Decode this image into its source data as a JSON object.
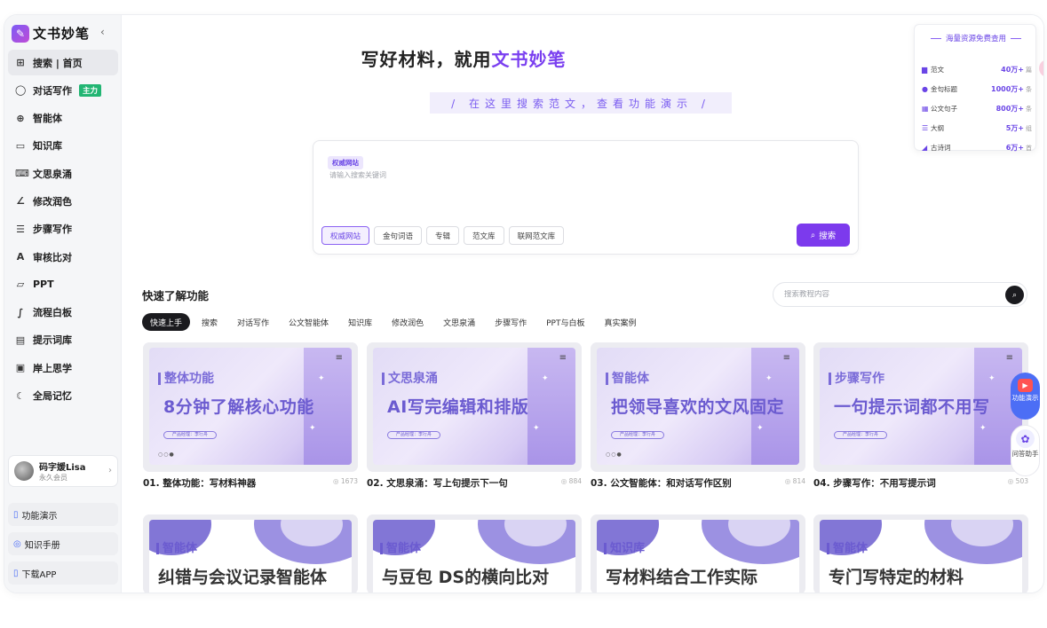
{
  "logo": {
    "text": "文书妙笔",
    "collapse_icon": "chevron-left-icon"
  },
  "sidebar": {
    "items": [
      {
        "icon": "grid-icon",
        "glyph": "⊞",
        "label": "搜索 | 首页",
        "active": true
      },
      {
        "icon": "chat-icon",
        "glyph": "◯",
        "label": "对话写作",
        "badge": "主力"
      },
      {
        "icon": "agent-icon",
        "glyph": "⊕",
        "label": "智能体"
      },
      {
        "icon": "book-icon",
        "glyph": "▭",
        "label": "知识库"
      },
      {
        "icon": "keyboard-icon",
        "glyph": "⌨",
        "label": "文思泉涌"
      },
      {
        "icon": "pen-icon",
        "glyph": "∠",
        "label": "修改润色"
      },
      {
        "icon": "list-icon",
        "glyph": "☰",
        "label": "步骤写作"
      },
      {
        "icon": "check-icon",
        "glyph": "A",
        "label": "审核比对"
      },
      {
        "icon": "ppt-icon",
        "glyph": "▱",
        "label": "PPT"
      },
      {
        "icon": "flow-icon",
        "glyph": "∫",
        "label": "流程白板"
      },
      {
        "icon": "prompt-icon",
        "glyph": "▤",
        "label": "提示词库"
      },
      {
        "icon": "video-icon",
        "glyph": "▣",
        "label": "岸上思学"
      },
      {
        "icon": "memory-icon",
        "glyph": "☾",
        "label": "全局记忆"
      }
    ],
    "user": {
      "name": "码字媛Lisa",
      "sub": "永久会员"
    },
    "bottom": [
      {
        "icon": "demo-icon",
        "glyph": "▯",
        "label": "功能演示"
      },
      {
        "icon": "manual-icon",
        "glyph": "◎",
        "label": "知识手册"
      },
      {
        "icon": "app-icon",
        "glyph": "▯",
        "label": "下载APP"
      }
    ]
  },
  "hero": {
    "title_prefix": "写好材料，就用",
    "title_accent": "文书妙笔",
    "subtitle": "/ 在这里搜索范文，查看功能演示 /"
  },
  "search": {
    "tag": "权威网站",
    "placeholder": "请输入搜索关键词",
    "value": "",
    "chips": [
      "权威网站",
      "金句词语",
      "专辑",
      "范文库",
      "联网范文库"
    ],
    "active_chip": 0,
    "button": "搜索"
  },
  "resources": {
    "title": "海量资源免费查用",
    "rows": [
      {
        "icon": "book-icon",
        "glyph": "▆",
        "label": "范文",
        "value": "40万+",
        "unit": "篇"
      },
      {
        "icon": "quote-icon",
        "glyph": "●",
        "label": "金句标题",
        "value": "1000万+",
        "unit": "条"
      },
      {
        "icon": "doc-icon",
        "glyph": "▦",
        "label": "公文句子",
        "value": "800万+",
        "unit": "条"
      },
      {
        "icon": "outline-icon",
        "glyph": "☰",
        "label": "大纲",
        "value": "5万+",
        "unit": "组"
      },
      {
        "icon": "poem-icon",
        "glyph": "◢",
        "label": "古诗词",
        "value": "6万+",
        "unit": "首"
      }
    ]
  },
  "quick": {
    "title": "快速了解功能",
    "search_placeholder": "搜索教程内容",
    "tabs": [
      "快速上手",
      "搜索",
      "对话写作",
      "公文智能体",
      "知识库",
      "修改润色",
      "文思泉涌",
      "步骤写作",
      "PPT与白板",
      "真实案例"
    ],
    "active_tab": 0,
    "cards": [
      {
        "tag": "整体功能",
        "big": "8分钟了解核心功能",
        "chip": "产品经理：李行舟",
        "title": "01. 整体功能：写材料神器",
        "views": "1673"
      },
      {
        "tag": "文思泉涌",
        "big": "AI写完编辑和排版",
        "chip": "产品经理：李行舟",
        "title": "02. 文思泉涌：写上句提示下一句",
        "views": "884"
      },
      {
        "tag": "智能体",
        "big": "把领导喜欢的文风固定",
        "chip": "产品经理：李行舟",
        "title": "03. 公文智能体：和对话写作区别",
        "views": "814"
      },
      {
        "tag": "步骤写作",
        "big": "一句提示词都不用写",
        "chip": "产品经理：李行舟",
        "title": "04. 步骤写作：不用写提示词",
        "views": "503"
      }
    ],
    "cards2": [
      {
        "tag": "智能体",
        "big": "纠错与会议记录智能体"
      },
      {
        "tag": "智能体",
        "big": "与豆包 DS的横向比对"
      },
      {
        "tag": "知识库",
        "big": "写材料结合工作实际"
      },
      {
        "tag": "智能体",
        "big": "专门写特定的材料"
      }
    ]
  },
  "floating": [
    {
      "icon": "play-icon",
      "glyph": "▶",
      "label": "功能演示"
    },
    {
      "icon": "assistant-icon",
      "glyph": "✿",
      "label": "问答助手"
    }
  ]
}
